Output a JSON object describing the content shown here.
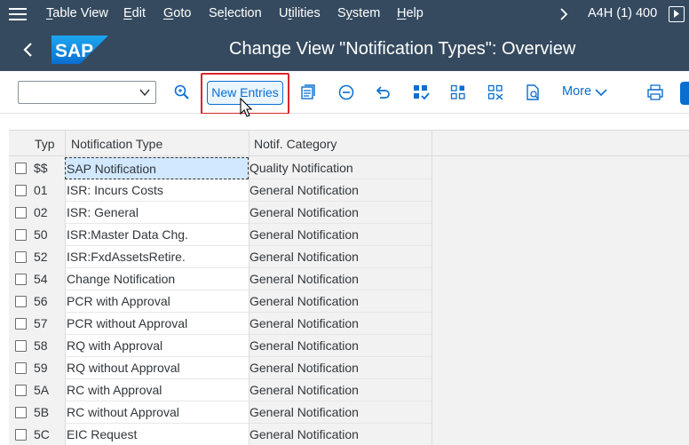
{
  "menubar": {
    "items": [
      "Table View",
      "Edit",
      "Goto",
      "Selection",
      "Utilities",
      "System",
      "Help"
    ],
    "system_info": "A4H (1) 400"
  },
  "titlebar": {
    "logo_text": "SAP",
    "title": "Change View \"Notification Types\": Overview"
  },
  "toolbar": {
    "dropdown_value": "",
    "new_entries_label": "New Entries",
    "more_label": "More"
  },
  "table": {
    "columns": [
      "Typ",
      "Notification Type",
      "Notif. Category"
    ],
    "rows": [
      {
        "typ": "$$",
        "type": "SAP Notification",
        "category": "Quality Notification"
      },
      {
        "typ": "01",
        "type": "ISR: Incurs Costs",
        "category": "General Notification"
      },
      {
        "typ": "02",
        "type": "ISR: General",
        "category": "General Notification"
      },
      {
        "typ": "50",
        "type": "ISR:Master Data Chg.",
        "category": "General Notification"
      },
      {
        "typ": "52",
        "type": "ISR:FxdAssetsRetire.",
        "category": "General Notification"
      },
      {
        "typ": "54",
        "type": "Change Notification",
        "category": "General Notification"
      },
      {
        "typ": "56",
        "type": "PCR with Approval",
        "category": "General Notification"
      },
      {
        "typ": "57",
        "type": "PCR without Approval",
        "category": "General Notification"
      },
      {
        "typ": "58",
        "type": "RQ with Approval",
        "category": "General Notification"
      },
      {
        "typ": "59",
        "type": "RQ without Approval",
        "category": "General Notification"
      },
      {
        "typ": "5A",
        "type": "RC with Approval",
        "category": "General Notification"
      },
      {
        "typ": "5B",
        "type": "RC without Approval",
        "category": "General Notification"
      },
      {
        "typ": "5C",
        "type": "EIC Request",
        "category": "General Notification"
      }
    ]
  },
  "colors": {
    "shell": "#354a5f",
    "accent": "#0a6ed1",
    "highlight": "#d9262c"
  }
}
